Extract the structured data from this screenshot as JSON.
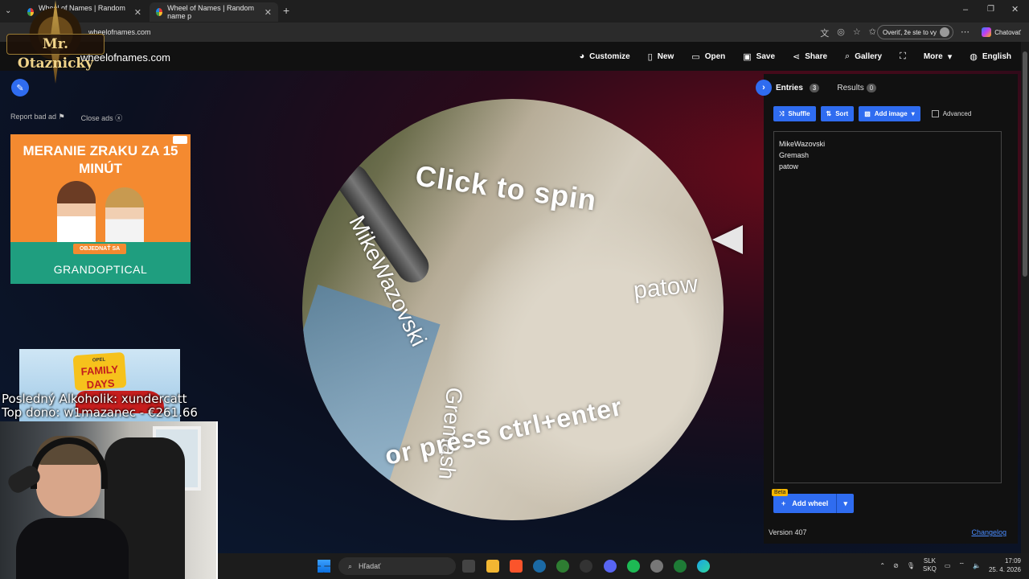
{
  "browser": {
    "tabs": [
      {
        "title": "Wheel of Names | Random name p",
        "active": false
      },
      {
        "title": "Wheel of Names | Random name p",
        "active": true
      }
    ],
    "url": "wheelofnames.com",
    "verify_label": "Overiť, že ste to vy",
    "copilot_label": "Chatovať"
  },
  "site": {
    "name": "wheelofnames.com",
    "menu": [
      {
        "label": "Customize",
        "icon": "palette-icon"
      },
      {
        "label": "New",
        "icon": "new-file-icon"
      },
      {
        "label": "Open",
        "icon": "folder-open-icon"
      },
      {
        "label": "Save",
        "icon": "save-icon"
      },
      {
        "label": "Share",
        "icon": "share-icon"
      },
      {
        "label": "Gallery",
        "icon": "search-icon"
      },
      {
        "label": "",
        "icon": "fullscreen-icon"
      },
      {
        "label": "More",
        "icon": "chevron-down-icon"
      },
      {
        "label": "English",
        "icon": "globe-icon"
      }
    ]
  },
  "ads": {
    "report_label": "Report bad ad",
    "close_label": "Close ads",
    "banner1": {
      "headline": "MERANIE ZRAKU ZA 15 MINÚT",
      "cta": "OBJEDNAŤ SA",
      "brand": "GRANDOPTICAL"
    },
    "banner2": {
      "badge": "OPEL",
      "headline": "FAMILY DAYS"
    }
  },
  "wheel": {
    "prompt_top": "Click to spin",
    "prompt_bottom": "or press ctrl+enter",
    "entries_on_wheel": [
      "MikeWazovski",
      "Gremash",
      "patow"
    ]
  },
  "panel": {
    "tab_entries": "Entries",
    "entries_count": "3",
    "tab_results": "Results",
    "results_count": "0",
    "buttons": {
      "shuffle": "Shuffle",
      "sort": "Sort",
      "add_image": "Add image",
      "advanced": "Advanced"
    },
    "entries": [
      "MikeWazovski",
      "Gremash",
      "patow"
    ],
    "beta": "Beta",
    "add_wheel": "Add wheel",
    "version": "Version 407",
    "changelog": "Changelog"
  },
  "overlay": {
    "streamer": "Mr. Otaznicky",
    "last_alcoholic": "Posledný Alkoholik: xundercatt",
    "top_donor": "Top dono: w1mazanec - €261.66"
  },
  "taskbar": {
    "search_placeholder": "Hľadať",
    "lang_top": "SLK",
    "lang_bottom": "SKQ",
    "time": "17:09",
    "date": "25. 4. 2026"
  }
}
